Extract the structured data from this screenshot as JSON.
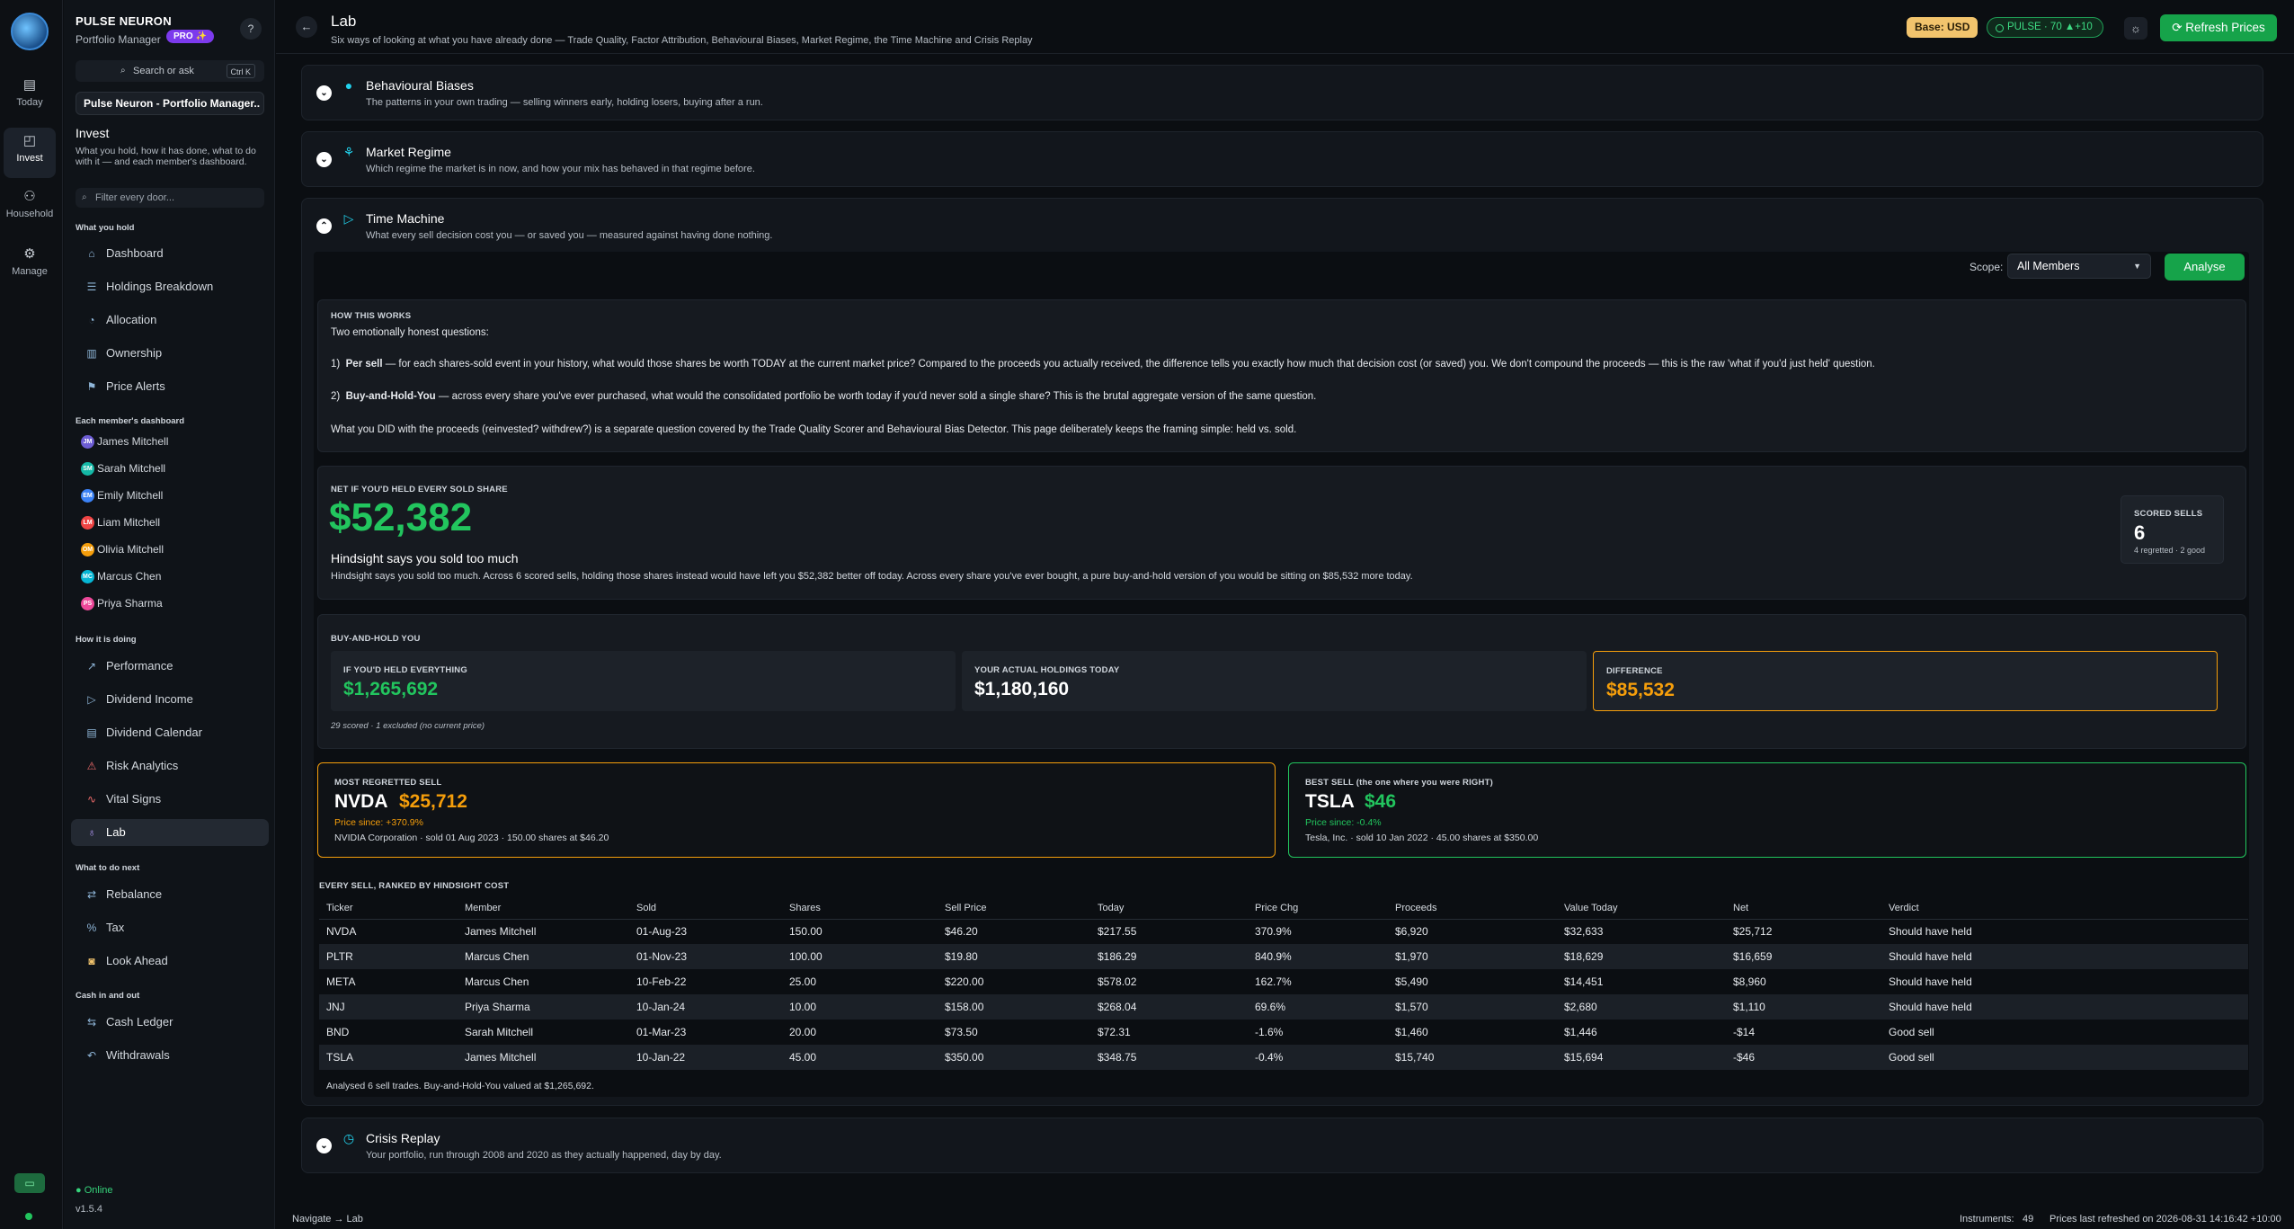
{
  "rail": {
    "items": [
      {
        "label": "Today",
        "icon": "calendar-icon"
      },
      {
        "label": "Invest",
        "icon": "chart-icon"
      },
      {
        "label": "Household",
        "icon": "people-icon"
      },
      {
        "label": "Manage",
        "icon": "gear-icon"
      }
    ]
  },
  "sidebar": {
    "brand": "PULSE NEURON",
    "subtitle": "Portfolio Manager",
    "pro_badge": "PRO ✨",
    "help": "?",
    "search_placeholder": "Search or ask",
    "search_shortcut": "Ctrl K",
    "workspace": "Pulse Neuron - Portfolio Manager..",
    "section_title": "Invest",
    "section_desc": "What you hold, how it has done, what to do with it — and each member's dashboard.",
    "filter_placeholder": "Filter every door...",
    "groups": {
      "hold": "What you hold",
      "members": "Each member's dashboard",
      "doing": "How it is doing",
      "next": "What to do next",
      "cash": "Cash in and out"
    },
    "hold_items": [
      "Dashboard",
      "Holdings Breakdown",
      "Allocation",
      "Ownership",
      "Price Alerts"
    ],
    "members": [
      {
        "initials": "JM",
        "name": "James Mitchell",
        "color": "#6d5dd3"
      },
      {
        "initials": "SM",
        "name": "Sarah Mitchell",
        "color": "#14b8a6"
      },
      {
        "initials": "EM",
        "name": "Emily Mitchell",
        "color": "#3b82f6"
      },
      {
        "initials": "LM",
        "name": "Liam Mitchell",
        "color": "#ef4444"
      },
      {
        "initials": "OM",
        "name": "Olivia Mitchell",
        "color": "#f59e0b"
      },
      {
        "initials": "MC",
        "name": "Marcus Chen",
        "color": "#06b6d4"
      },
      {
        "initials": "PS",
        "name": "Priya Sharma",
        "color": "#ec4899"
      }
    ],
    "doing_items": [
      "Performance",
      "Dividend Income",
      "Dividend Calendar",
      "Risk Analytics",
      "Vital Signs",
      "Lab"
    ],
    "next_items": [
      "Rebalance",
      "Tax",
      "Look Ahead"
    ],
    "cash_items": [
      "Cash Ledger",
      "Withdrawals"
    ],
    "online": "Online",
    "version": "v1.5.4"
  },
  "header": {
    "title": "Lab",
    "subtitle": "Six ways of looking at what you have already done — Trade Quality, Factor Attribution, Behavioural Biases, Market Regime, the Time Machine and Crisis Replay",
    "base": "Base: USD",
    "pulse": "PULSE · 70  ▲+10",
    "refresh": "Refresh Prices"
  },
  "panels": {
    "biases": {
      "title": "Behavioural Biases",
      "desc": "The patterns in your own trading — selling winners early, holding losers, buying after a run."
    },
    "regime": {
      "title": "Market Regime",
      "desc": "Which regime the market is in now, and how your mix has behaved in that regime before."
    },
    "time_machine": {
      "title": "Time Machine",
      "desc": "What every sell decision cost you — or saved you — measured against having done nothing."
    },
    "crisis": {
      "title": "Crisis Replay",
      "desc": "Your portfolio, run through 2008 and 2020 as they actually happened, day by day."
    }
  },
  "controls": {
    "scope_label": "Scope:",
    "scope_value": "All Members",
    "analyse": "Analyse"
  },
  "how": {
    "label": "HOW THIS WORKS",
    "intro": "Two emotionally honest questions:",
    "q1_num": "1)",
    "q1_bold": "Per sell",
    "q1_text": " —  for each shares-sold event in your history, what would those shares be worth TODAY at the current market price? Compared to the proceeds you actually received, the difference tells you exactly how much that decision cost (or saved) you. We don't compound the proceeds — this is the raw 'what if you'd just held' question.",
    "q2_num": "2)",
    "q2_bold": "Buy-and-Hold-You",
    "q2_text": " —  across every share you've ever purchased, what would the consolidated portfolio be worth today if you'd never sold a single share? This is the brutal aggregate version of the same question.",
    "footer": "What you DID with the proceeds (reinvested? withdrew?) is a separate question covered by the Trade Quality Scorer and Behavioural Bias Detector. This page deliberately keeps the framing simple: held vs. sold."
  },
  "net": {
    "label": "NET IF YOU'D HELD EVERY SOLD SHARE",
    "value": "$52,382",
    "headline": "Hindsight says you sold too much",
    "desc": "Hindsight says you sold too much. Across 6 scored sells, holding those shares instead would have left you $52,382 better off today. Across every share you've ever bought, a pure buy-and-hold version of you would be sitting on $85,532 more today.",
    "scored_label": "SCORED SELLS",
    "scored_value": "6",
    "scored_sub": "4 regretted · 2 good"
  },
  "bah": {
    "label": "BUY-AND-HOLD YOU",
    "held_label": "IF YOU'D HELD EVERYTHING",
    "held_value": "$1,265,692",
    "actual_label": "YOUR ACTUAL HOLDINGS TODAY",
    "actual_value": "$1,180,160",
    "diff_label": "DIFFERENCE",
    "diff_value": "$85,532",
    "note": "29 scored · 1 excluded (no current price)"
  },
  "regret": {
    "label": "MOST REGRETTED SELL",
    "ticker": "NVDA",
    "amount": "$25,712",
    "since": "Price since: +370.9%",
    "detail": "NVIDIA Corporation · sold 01 Aug 2023 · 150.00 shares at $46.20"
  },
  "best": {
    "label": "BEST SELL (the one where you were RIGHT)",
    "ticker": "TSLA",
    "amount": "$46",
    "since": "Price since: -0.4%",
    "detail": "Tesla, Inc. · sold 10 Jan 2022 · 45.00 shares at $350.00"
  },
  "table": {
    "label": "EVERY SELL, RANKED BY HINDSIGHT COST",
    "headers": [
      "Ticker",
      "Member",
      "Sold",
      "Shares",
      "Sell Price",
      "Today",
      "Price Chg",
      "Proceeds",
      "Value Today",
      "Net",
      "Verdict"
    ],
    "rows": [
      [
        "NVDA",
        "James Mitchell",
        "01-Aug-23",
        "150.00",
        "$46.20",
        "$217.55",
        "370.9%",
        "$6,920",
        "$32,633",
        "$25,712",
        "Should have held"
      ],
      [
        "PLTR",
        "Marcus Chen",
        "01-Nov-23",
        "100.00",
        "$19.80",
        "$186.29",
        "840.9%",
        "$1,970",
        "$18,629",
        "$16,659",
        "Should have held"
      ],
      [
        "META",
        "Marcus Chen",
        "10-Feb-22",
        "25.00",
        "$220.00",
        "$578.02",
        "162.7%",
        "$5,490",
        "$14,451",
        "$8,960",
        "Should have held"
      ],
      [
        "JNJ",
        "Priya Sharma",
        "10-Jan-24",
        "10.00",
        "$158.00",
        "$268.04",
        "69.6%",
        "$1,570",
        "$2,680",
        "$1,110",
        "Should have held"
      ],
      [
        "BND",
        "Sarah Mitchell",
        "01-Mar-23",
        "20.00",
        "$73.50",
        "$72.31",
        "-1.6%",
        "$1,460",
        "$1,446",
        "-$14",
        "Good sell"
      ],
      [
        "TSLA",
        "James Mitchell",
        "10-Jan-22",
        "45.00",
        "$350.00",
        "$348.75",
        "-0.4%",
        "$15,740",
        "$15,694",
        "-$46",
        "Good sell"
      ]
    ],
    "footer": "Analysed 6 sell trades. Buy-and-Hold-You valued at $1,265,692."
  },
  "status": {
    "nav": "Navigate → Lab",
    "instruments_label": "Instruments:",
    "instruments": "49",
    "refreshed": "Prices last refreshed on 2026-08-31 14:16:42 +10:00"
  }
}
